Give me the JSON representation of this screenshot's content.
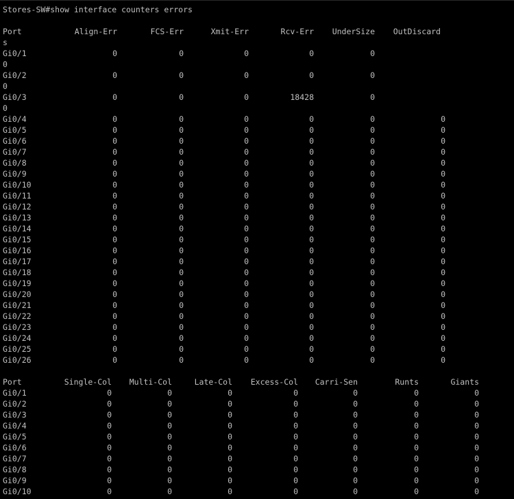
{
  "terminal": {
    "prompt_command": "Stores-SW#show interface counters errors"
  },
  "table1": {
    "headers": [
      "Port",
      "Align-Err",
      "FCS-Err",
      "Xmit-Err",
      "Rcv-Err",
      "UnderSize",
      "OutDiscard"
    ],
    "header_wrap": "s",
    "rows": [
      {
        "port": "Gi0/1",
        "values": [
          "0",
          "0",
          "0",
          "0",
          "0",
          ""
        ],
        "wrap": "0"
      },
      {
        "port": "Gi0/2",
        "values": [
          "0",
          "0",
          "0",
          "0",
          "0",
          ""
        ],
        "wrap": "0"
      },
      {
        "port": "Gi0/3",
        "values": [
          "0",
          "0",
          "0",
          "18428",
          "0",
          ""
        ],
        "wrap": "0"
      },
      {
        "port": "Gi0/4",
        "values": [
          "0",
          "0",
          "0",
          "0",
          "0",
          "0"
        ]
      },
      {
        "port": "Gi0/5",
        "values": [
          "0",
          "0",
          "0",
          "0",
          "0",
          "0"
        ]
      },
      {
        "port": "Gi0/6",
        "values": [
          "0",
          "0",
          "0",
          "0",
          "0",
          "0"
        ]
      },
      {
        "port": "Gi0/7",
        "values": [
          "0",
          "0",
          "0",
          "0",
          "0",
          "0"
        ]
      },
      {
        "port": "Gi0/8",
        "values": [
          "0",
          "0",
          "0",
          "0",
          "0",
          "0"
        ]
      },
      {
        "port": "Gi0/9",
        "values": [
          "0",
          "0",
          "0",
          "0",
          "0",
          "0"
        ]
      },
      {
        "port": "Gi0/10",
        "values": [
          "0",
          "0",
          "0",
          "0",
          "0",
          "0"
        ]
      },
      {
        "port": "Gi0/11",
        "values": [
          "0",
          "0",
          "0",
          "0",
          "0",
          "0"
        ]
      },
      {
        "port": "Gi0/12",
        "values": [
          "0",
          "0",
          "0",
          "0",
          "0",
          "0"
        ]
      },
      {
        "port": "Gi0/13",
        "values": [
          "0",
          "0",
          "0",
          "0",
          "0",
          "0"
        ]
      },
      {
        "port": "Gi0/14",
        "values": [
          "0",
          "0",
          "0",
          "0",
          "0",
          "0"
        ]
      },
      {
        "port": "Gi0/15",
        "values": [
          "0",
          "0",
          "0",
          "0",
          "0",
          "0"
        ]
      },
      {
        "port": "Gi0/16",
        "values": [
          "0",
          "0",
          "0",
          "0",
          "0",
          "0"
        ]
      },
      {
        "port": "Gi0/17",
        "values": [
          "0",
          "0",
          "0",
          "0",
          "0",
          "0"
        ]
      },
      {
        "port": "Gi0/18",
        "values": [
          "0",
          "0",
          "0",
          "0",
          "0",
          "0"
        ]
      },
      {
        "port": "Gi0/19",
        "values": [
          "0",
          "0",
          "0",
          "0",
          "0",
          "0"
        ]
      },
      {
        "port": "Gi0/20",
        "values": [
          "0",
          "0",
          "0",
          "0",
          "0",
          "0"
        ]
      },
      {
        "port": "Gi0/21",
        "values": [
          "0",
          "0",
          "0",
          "0",
          "0",
          "0"
        ]
      },
      {
        "port": "Gi0/22",
        "values": [
          "0",
          "0",
          "0",
          "0",
          "0",
          "0"
        ]
      },
      {
        "port": "Gi0/23",
        "values": [
          "0",
          "0",
          "0",
          "0",
          "0",
          "0"
        ]
      },
      {
        "port": "Gi0/24",
        "values": [
          "0",
          "0",
          "0",
          "0",
          "0",
          "0"
        ]
      },
      {
        "port": "Gi0/25",
        "values": [
          "0",
          "0",
          "0",
          "0",
          "0",
          "0"
        ]
      },
      {
        "port": "Gi0/26",
        "values": [
          "0",
          "0",
          "0",
          "0",
          "0",
          "0"
        ]
      }
    ]
  },
  "table2": {
    "headers": [
      "Port",
      "Single-Col",
      "Multi-Col",
      "Late-Col",
      "Excess-Col",
      "Carri-Sen",
      "Runts",
      "Giants"
    ],
    "rows": [
      {
        "port": "Gi0/1",
        "values": [
          "0",
          "0",
          "0",
          "0",
          "0",
          "0",
          "0"
        ]
      },
      {
        "port": "Gi0/2",
        "values": [
          "0",
          "0",
          "0",
          "0",
          "0",
          "0",
          "0"
        ]
      },
      {
        "port": "Gi0/3",
        "values": [
          "0",
          "0",
          "0",
          "0",
          "0",
          "0",
          "0"
        ]
      },
      {
        "port": "Gi0/4",
        "values": [
          "0",
          "0",
          "0",
          "0",
          "0",
          "0",
          "0"
        ]
      },
      {
        "port": "Gi0/5",
        "values": [
          "0",
          "0",
          "0",
          "0",
          "0",
          "0",
          "0"
        ]
      },
      {
        "port": "Gi0/6",
        "values": [
          "0",
          "0",
          "0",
          "0",
          "0",
          "0",
          "0"
        ]
      },
      {
        "port": "Gi0/7",
        "values": [
          "0",
          "0",
          "0",
          "0",
          "0",
          "0",
          "0"
        ]
      },
      {
        "port": "Gi0/8",
        "values": [
          "0",
          "0",
          "0",
          "0",
          "0",
          "0",
          "0"
        ]
      },
      {
        "port": "Gi0/9",
        "values": [
          "0",
          "0",
          "0",
          "0",
          "0",
          "0",
          "0"
        ]
      },
      {
        "port": "Gi0/10",
        "values": [
          "0",
          "0",
          "0",
          "0",
          "0",
          "0",
          "0"
        ]
      }
    ]
  }
}
